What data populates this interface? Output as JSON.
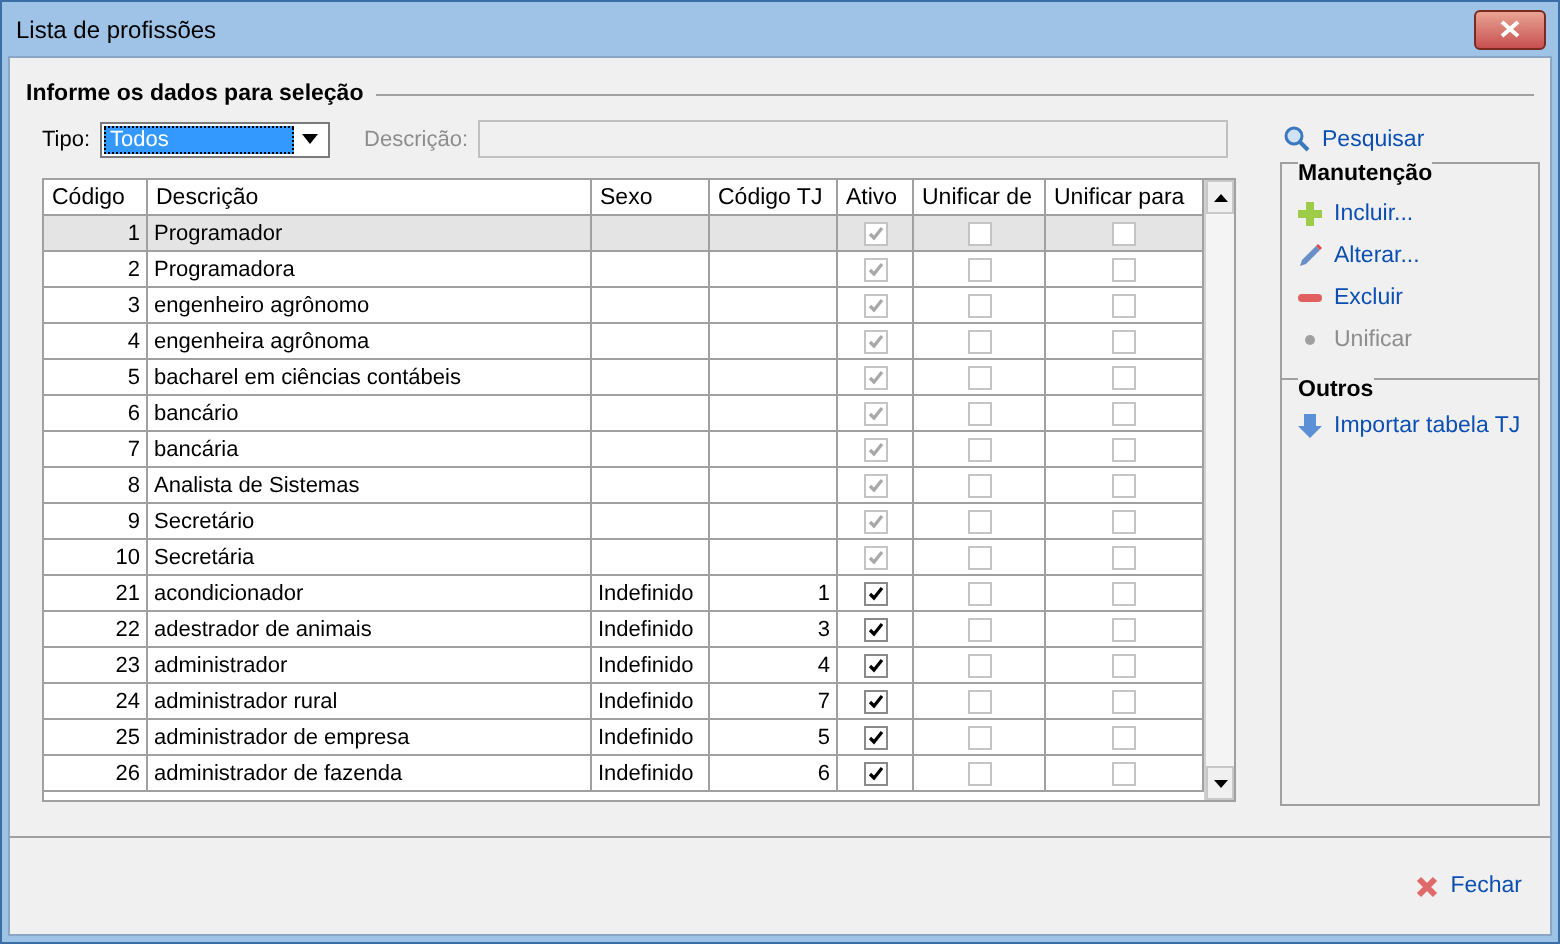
{
  "window": {
    "title": "Lista de profissões"
  },
  "selection_group": {
    "title": "Informe os dados para seleção",
    "type_label": "Tipo:",
    "type_value": "Todos",
    "description_label": "Descrição:",
    "description_disabled": true,
    "search_link": "Pesquisar"
  },
  "table": {
    "columns": [
      "Código",
      "Descrição",
      "Sexo",
      "Código TJ",
      "Ativo",
      "Unificar de",
      "Unificar para"
    ],
    "rows": [
      {
        "code": "1",
        "description": "Programador",
        "sex": "",
        "tj_code": "",
        "active": true,
        "disabled": true,
        "merge_from": false,
        "merge_to": false,
        "selected": true
      },
      {
        "code": "2",
        "description": "Programadora",
        "sex": "",
        "tj_code": "",
        "active": true,
        "disabled": true,
        "merge_from": false,
        "merge_to": false,
        "selected": false
      },
      {
        "code": "3",
        "description": "engenheiro agrônomo",
        "sex": "",
        "tj_code": "",
        "active": true,
        "disabled": true,
        "merge_from": false,
        "merge_to": false,
        "selected": false
      },
      {
        "code": "4",
        "description": "engenheira agrônoma",
        "sex": "",
        "tj_code": "",
        "active": true,
        "disabled": true,
        "merge_from": false,
        "merge_to": false,
        "selected": false
      },
      {
        "code": "5",
        "description": "bacharel em ciências contábeis",
        "sex": "",
        "tj_code": "",
        "active": true,
        "disabled": true,
        "merge_from": false,
        "merge_to": false,
        "selected": false
      },
      {
        "code": "6",
        "description": "bancário",
        "sex": "",
        "tj_code": "",
        "active": true,
        "disabled": true,
        "merge_from": false,
        "merge_to": false,
        "selected": false
      },
      {
        "code": "7",
        "description": "bancária",
        "sex": "",
        "tj_code": "",
        "active": true,
        "disabled": true,
        "merge_from": false,
        "merge_to": false,
        "selected": false
      },
      {
        "code": "8",
        "description": "Analista de Sistemas",
        "sex": "",
        "tj_code": "",
        "active": true,
        "disabled": true,
        "merge_from": false,
        "merge_to": false,
        "selected": false
      },
      {
        "code": "9",
        "description": "Secretário",
        "sex": "",
        "tj_code": "",
        "active": true,
        "disabled": true,
        "merge_from": false,
        "merge_to": false,
        "selected": false
      },
      {
        "code": "10",
        "description": "Secretária",
        "sex": "",
        "tj_code": "",
        "active": true,
        "disabled": true,
        "merge_from": false,
        "merge_to": false,
        "selected": false
      },
      {
        "code": "21",
        "description": "acondicionador",
        "sex": "Indefinido",
        "tj_code": "1",
        "active": true,
        "disabled": false,
        "merge_from": false,
        "merge_to": false,
        "selected": false
      },
      {
        "code": "22",
        "description": "adestrador de animais",
        "sex": "Indefinido",
        "tj_code": "3",
        "active": true,
        "disabled": false,
        "merge_from": false,
        "merge_to": false,
        "selected": false
      },
      {
        "code": "23",
        "description": "administrador",
        "sex": "Indefinido",
        "tj_code": "4",
        "active": true,
        "disabled": false,
        "merge_from": false,
        "merge_to": false,
        "selected": false
      },
      {
        "code": "24",
        "description": "administrador rural",
        "sex": "Indefinido",
        "tj_code": "7",
        "active": true,
        "disabled": false,
        "merge_from": false,
        "merge_to": false,
        "selected": false
      },
      {
        "code": "25",
        "description": "administrador de empresa",
        "sex": "Indefinido",
        "tj_code": "5",
        "active": true,
        "disabled": false,
        "merge_from": false,
        "merge_to": false,
        "selected": false
      },
      {
        "code": "26",
        "description": "administrador de fazenda",
        "sex": "Indefinido",
        "tj_code": "6",
        "active": true,
        "disabled": false,
        "merge_from": false,
        "merge_to": false,
        "selected": false
      }
    ]
  },
  "maintenance": {
    "title": "Manutenção",
    "actions": [
      {
        "kind": "add",
        "label": "Incluir...",
        "disabled": false
      },
      {
        "kind": "edit",
        "label": "Alterar...",
        "disabled": false
      },
      {
        "kind": "delete",
        "label": "Excluir",
        "disabled": false
      },
      {
        "kind": "merge",
        "label": "Unificar",
        "disabled": true
      }
    ]
  },
  "others": {
    "title": "Outros",
    "actions": [
      {
        "kind": "import",
        "label": "Importar tabela TJ",
        "disabled": false
      }
    ]
  },
  "footer": {
    "close_link": "Fechar"
  }
}
